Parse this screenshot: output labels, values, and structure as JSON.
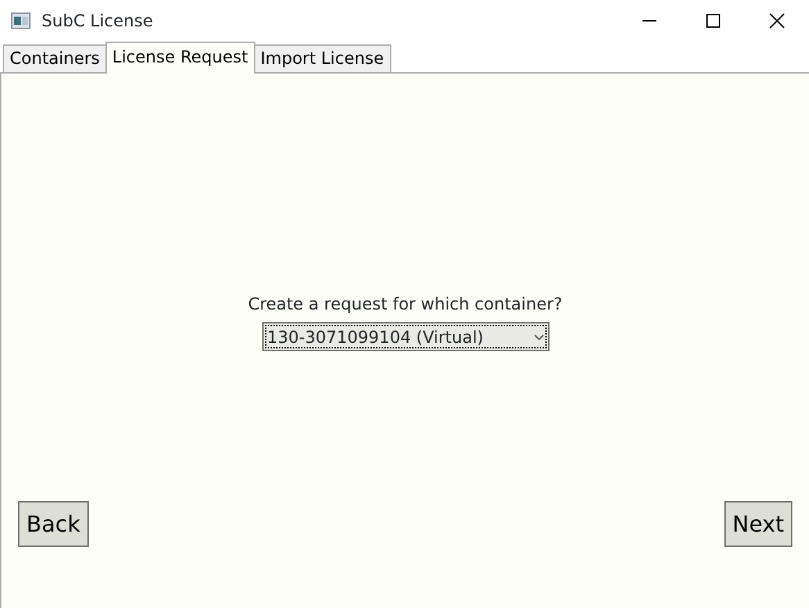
{
  "window": {
    "title": "SubC License"
  },
  "tabs": [
    {
      "label": "Containers",
      "selected": false
    },
    {
      "label": "License Request",
      "selected": true
    },
    {
      "label": "Import License",
      "selected": false
    }
  ],
  "prompt": "Create a request for which container?",
  "container_dropdown": {
    "value": "130-3071099104 (Virtual)"
  },
  "buttons": [
    {
      "label": "Back"
    },
    {
      "label": "Next"
    }
  ]
}
